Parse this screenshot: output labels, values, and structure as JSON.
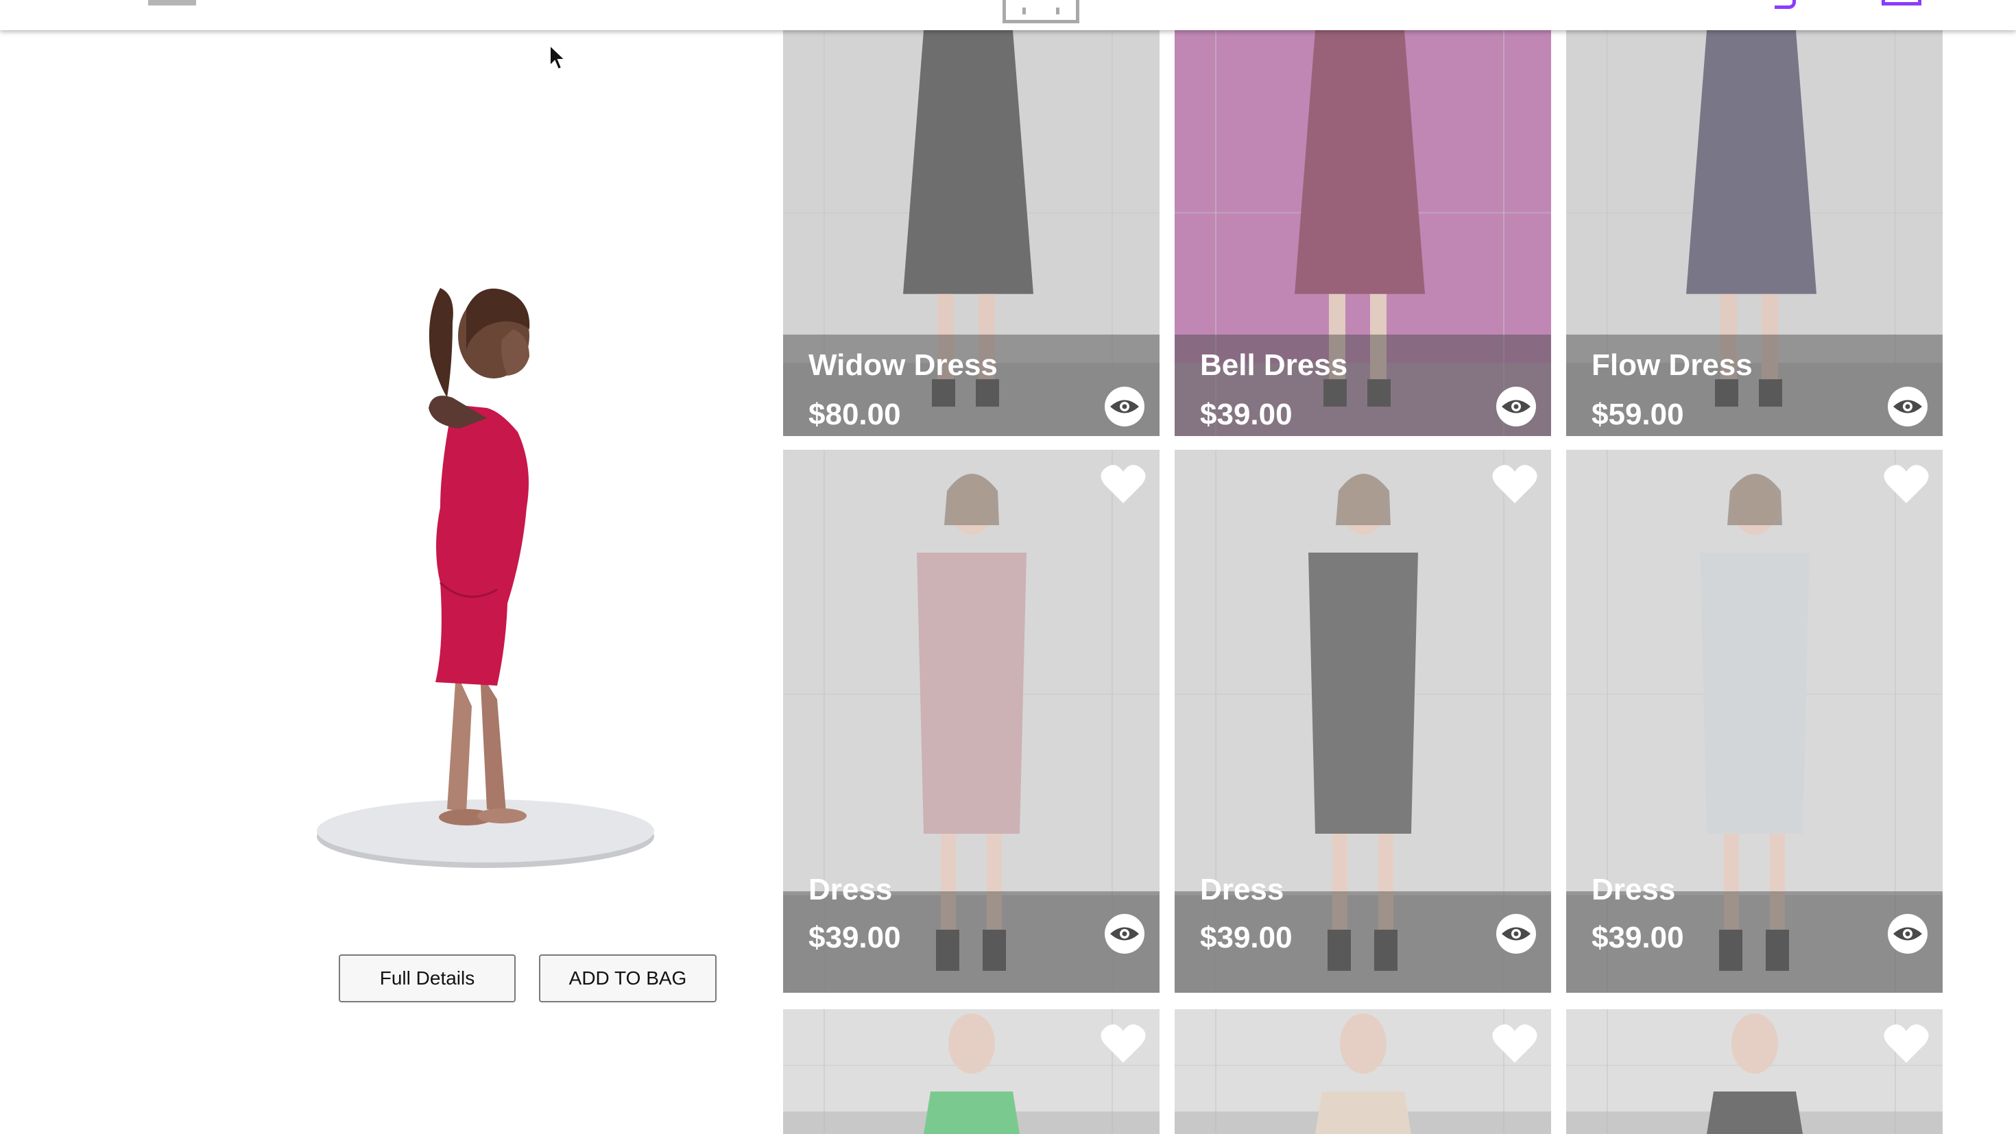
{
  "header": {
    "menu_icon": "hamburger-icon",
    "logo_icon": "fit-logo-icon",
    "wishlist_icon": "heart-outline-icon",
    "bag_icon": "shopping-bag-icon",
    "accent_color": "#8a3cff"
  },
  "viewer": {
    "model_description_icon": "3d-avatar-model",
    "full_details_label": "Full Details",
    "add_to_bag_label": "ADD TO BAG"
  },
  "products": [
    {
      "name": "Widow Dress",
      "price": "$80.00",
      "wishlist": false,
      "tint": "#bfbfbf",
      "dress": "#2a2a2a"
    },
    {
      "name": "Bell Dress",
      "price": "$39.00",
      "wishlist": false,
      "tint": "#a24f92",
      "dress": "#6b1838"
    },
    {
      "name": "Flow Dress",
      "price": "$59.00",
      "wishlist": false,
      "tint": "#bfbfbf",
      "dress": "#3a3550"
    },
    {
      "name": "Dress",
      "price": "$39.00",
      "wishlist": true,
      "tint": "#c4c4c4",
      "dress": "#b48c92"
    },
    {
      "name": "Dress",
      "price": "$39.00",
      "wishlist": true,
      "tint": "#c4c4c4",
      "dress": "#3d3d3d"
    },
    {
      "name": "Dress",
      "price": "$39.00",
      "wishlist": true,
      "tint": "#c8c8c8",
      "dress": "#bfc3c6"
    },
    {
      "name": "",
      "price": "",
      "wishlist": true,
      "tint": "#cfcfcf",
      "dress": "#3bb25a"
    },
    {
      "name": "",
      "price": "",
      "wishlist": true,
      "tint": "#cfcfcf",
      "dress": "#d8c2b0"
    },
    {
      "name": "",
      "price": "",
      "wishlist": true,
      "tint": "#cfcfcf",
      "dress": "#2e2e2e"
    }
  ],
  "icons": {
    "eye": "eye-icon",
    "heart": "heart-icon",
    "cursor": "mouse-cursor-icon"
  }
}
